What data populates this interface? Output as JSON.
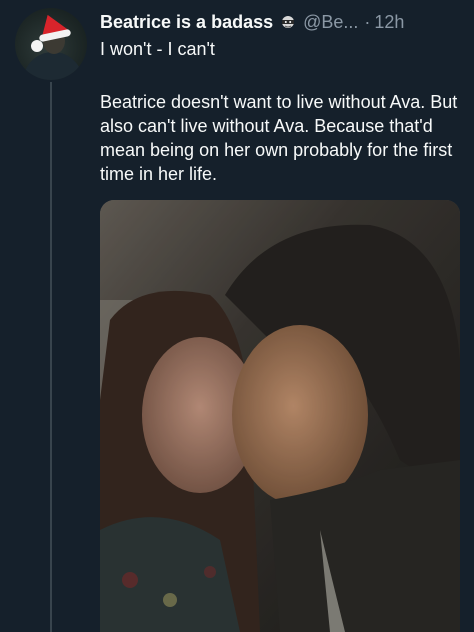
{
  "tweet": {
    "display_name": "Beatrice is a badass",
    "badge_icon": "ninja-face-icon",
    "handle": "@Be...",
    "separator": "·",
    "time": "12h",
    "subtitle": "I won't - I can't",
    "body": "Beatrice doesn't want to live without Ava. But also can't live without Ava. Because that'd mean being on her own probably for the first time in her life."
  },
  "colors": {
    "background": "#15202b",
    "text_primary": "#f7f9f9",
    "text_secondary": "#8b98a5",
    "thread_line": "#38444d"
  }
}
